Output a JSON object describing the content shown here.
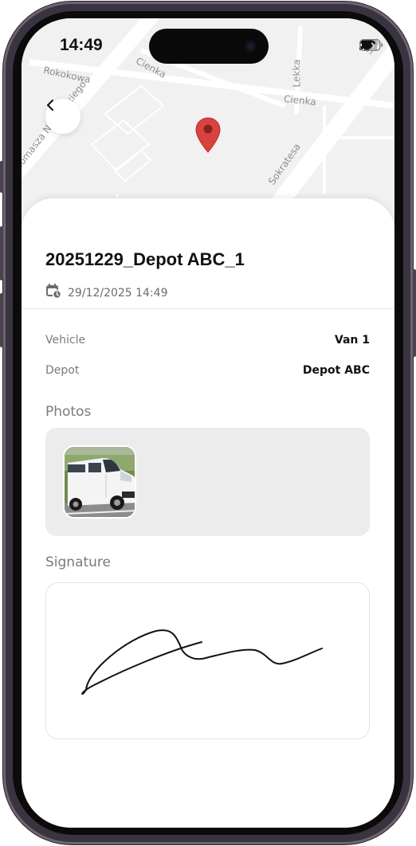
{
  "status": {
    "time": "14:49"
  },
  "map": {
    "streets": [
      "Rokokowa",
      "Cienka",
      "Lekka",
      "Cienka",
      "Tomasza Nocznickiego",
      "Sokratesa",
      "Sok"
    ]
  },
  "record": {
    "title": "20251229_Depot ABC_1",
    "datetime": "29/12/2025 14:49",
    "details": [
      {
        "label": "Vehicle",
        "value": "Van 1"
      },
      {
        "label": "Depot",
        "value": "Depot ABC"
      }
    ],
    "photos_heading": "Photos",
    "signature_heading": "Signature"
  },
  "icons": {
    "back": "chevron-left-icon",
    "pin": "map-pin-icon",
    "calendar": "calendar-clock-icon",
    "signal": "cellular-signal-icon",
    "wifi": "wifi-icon",
    "battery": "battery-icon"
  },
  "colors": {
    "pin": "#d9423f",
    "accent": "#111111"
  }
}
